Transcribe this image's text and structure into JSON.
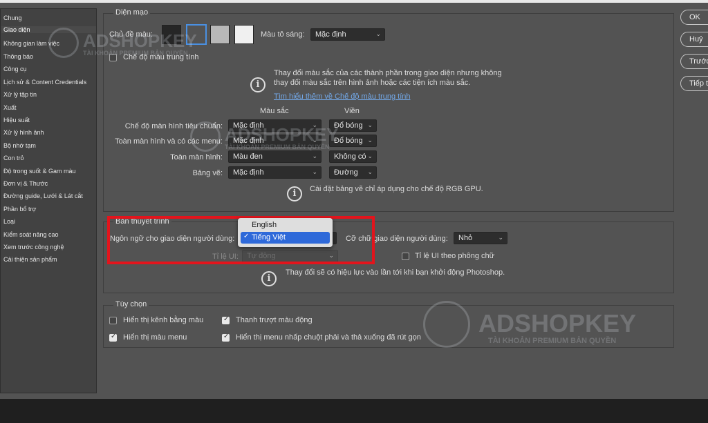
{
  "sidebar": {
    "items": [
      {
        "label": "Chung"
      },
      {
        "label": "Giao diện",
        "active": true
      },
      {
        "label": "Không gian làm việc"
      },
      {
        "label": "Thông báo"
      },
      {
        "label": "Công cụ"
      },
      {
        "label": "Lịch sử & Content Credentials"
      },
      {
        "label": "Xử lý tập tin"
      },
      {
        "label": "Xuất"
      },
      {
        "label": "Hiệu suất"
      },
      {
        "label": "Xử lý hình ảnh"
      },
      {
        "label": "Bộ nhớ tạm"
      },
      {
        "label": "Con trỏ"
      },
      {
        "label": "Độ trong suốt & Gam màu"
      },
      {
        "label": "Đơn vị & Thước"
      },
      {
        "label": "Đường guide, Lưới & Lát cắt"
      },
      {
        "label": "Phần bổ trợ"
      },
      {
        "label": "Loại"
      },
      {
        "label": "Kiểm soát nâng cao"
      },
      {
        "label": "Xem trước công nghệ"
      },
      {
        "label": "Cải thiện sản phẩm"
      }
    ]
  },
  "buttons": {
    "ok": "OK",
    "cancel": "Huỷ",
    "prev": "Trước",
    "next": "Tiếp t"
  },
  "appearance": {
    "title": "Diện mạo",
    "color_theme_label": "Chủ đề màu:",
    "theme_colors": [
      "#262626",
      "#535353",
      "#b8b8b8",
      "#f0f0f0"
    ],
    "highlight_label": "Màu tô sáng:",
    "highlight_value": "Mặc định",
    "neutral_mode_label": "Chế độ màu trung tính",
    "neutral_info_line1": "Thay đổi màu sắc của các thành phần trong giao diện nhưng không",
    "neutral_info_line2": "thay đổi màu sắc trên hình ảnh hoặc các tiện ích màu sắc.",
    "learn_more": "Tìm hiểu thêm về Chế độ màu trung tính",
    "col_color": "Màu sắc",
    "col_border": "Viền",
    "rows": [
      {
        "label": "Chế độ màn hình tiêu chuẩn:",
        "color": "Mặc định",
        "border": "Đổ bóng"
      },
      {
        "label": "Toàn màn hình và có các menu:",
        "color": "Mặc định",
        "border": "Đổ bóng"
      },
      {
        "label": "Toàn màn hình:",
        "color": "Màu đen",
        "border": "Không có"
      },
      {
        "label": "Bảng vẽ:",
        "color": "Mặc định",
        "border": "Đường"
      }
    ],
    "artboard_info": "Cài đặt bảng vẽ chỉ áp dụng cho chế độ RGB GPU."
  },
  "presentation": {
    "title": "Bản thuyết trình",
    "language_label": "Ngôn ngữ cho giao diện người dùng:",
    "language_options": [
      "English",
      "Tiếng Việt"
    ],
    "font_size_label": "Cỡ chữ giao diện người dùng:",
    "font_size_value": "Nhỏ",
    "ui_scale_label": "Tỉ lệ UI:",
    "ui_scale_value": "Tự động",
    "scale_with_font_label": "Tỉ lệ UI theo phông chữ",
    "restart_info": "Thay đổi sẽ có hiệu lực vào lần tới khi bạn khởi động Photoshop."
  },
  "options": {
    "title": "Tùy chọn",
    "show_channels": "Hiển thị kênh bằng màu",
    "dynamic_sliders": "Thanh trượt màu động",
    "show_menu_colors": "Hiển thị màu menu",
    "context_menus": "Hiển thị menu nhấp chuột phải và thả xuống đã rút gọn"
  },
  "watermark": {
    "brand": "ADSHOPKEY",
    "tagline": "TÀI KHOẢN PREMIUM BẢN QUYỀN"
  }
}
